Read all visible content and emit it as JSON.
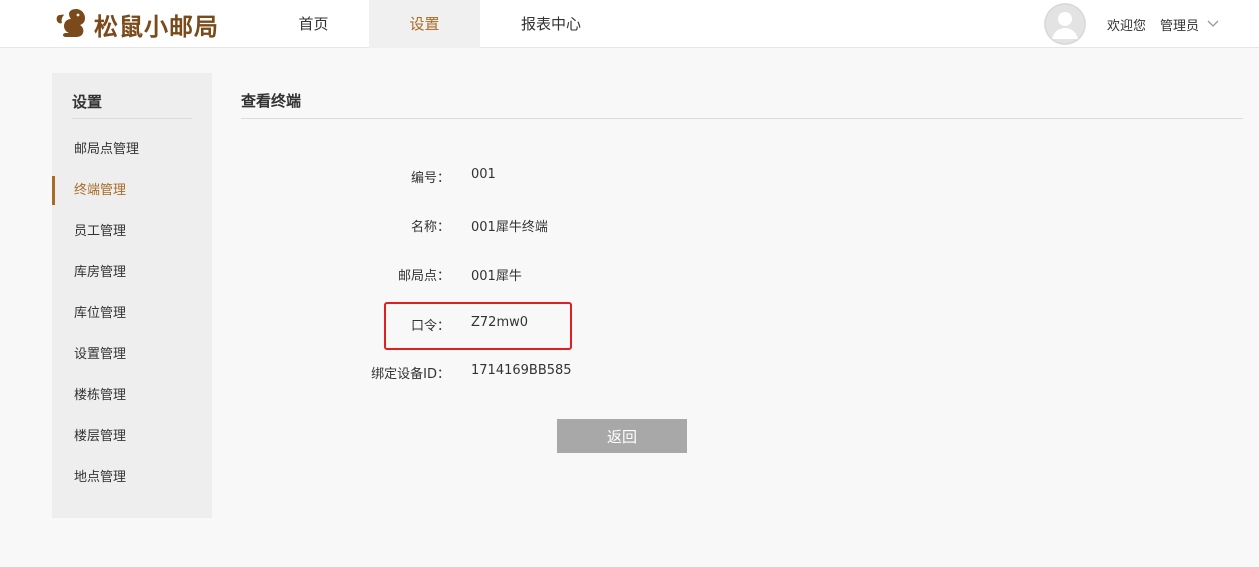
{
  "header": {
    "logo_text": "松鼠小邮局",
    "nav": [
      {
        "label": "首页"
      },
      {
        "label": "设置"
      },
      {
        "label": "报表中心"
      }
    ],
    "welcome": "欢迎您",
    "username": "管理员"
  },
  "sidebar": {
    "title": "设置",
    "items": [
      {
        "label": "邮局点管理"
      },
      {
        "label": "终端管理"
      },
      {
        "label": "员工管理"
      },
      {
        "label": "库房管理"
      },
      {
        "label": "库位管理"
      },
      {
        "label": "设置管理"
      },
      {
        "label": "楼栋管理"
      },
      {
        "label": "楼层管理"
      },
      {
        "label": "地点管理"
      }
    ]
  },
  "main": {
    "title": "查看终端",
    "fields": [
      {
        "label": "编号：",
        "value": "001"
      },
      {
        "label": "名称：",
        "value": "001犀牛终端"
      },
      {
        "label": "邮局点：",
        "value": "001犀牛"
      },
      {
        "label": "口令：",
        "value": "Z72mw0"
      },
      {
        "label": "绑定设备ID：",
        "value": "1714169BB585"
      }
    ],
    "back_label": "返回"
  },
  "colors": {
    "accent": "#a86b25",
    "logo": "#7a4a1a",
    "highlight": "#e02020",
    "button": "#a8a8a8"
  }
}
